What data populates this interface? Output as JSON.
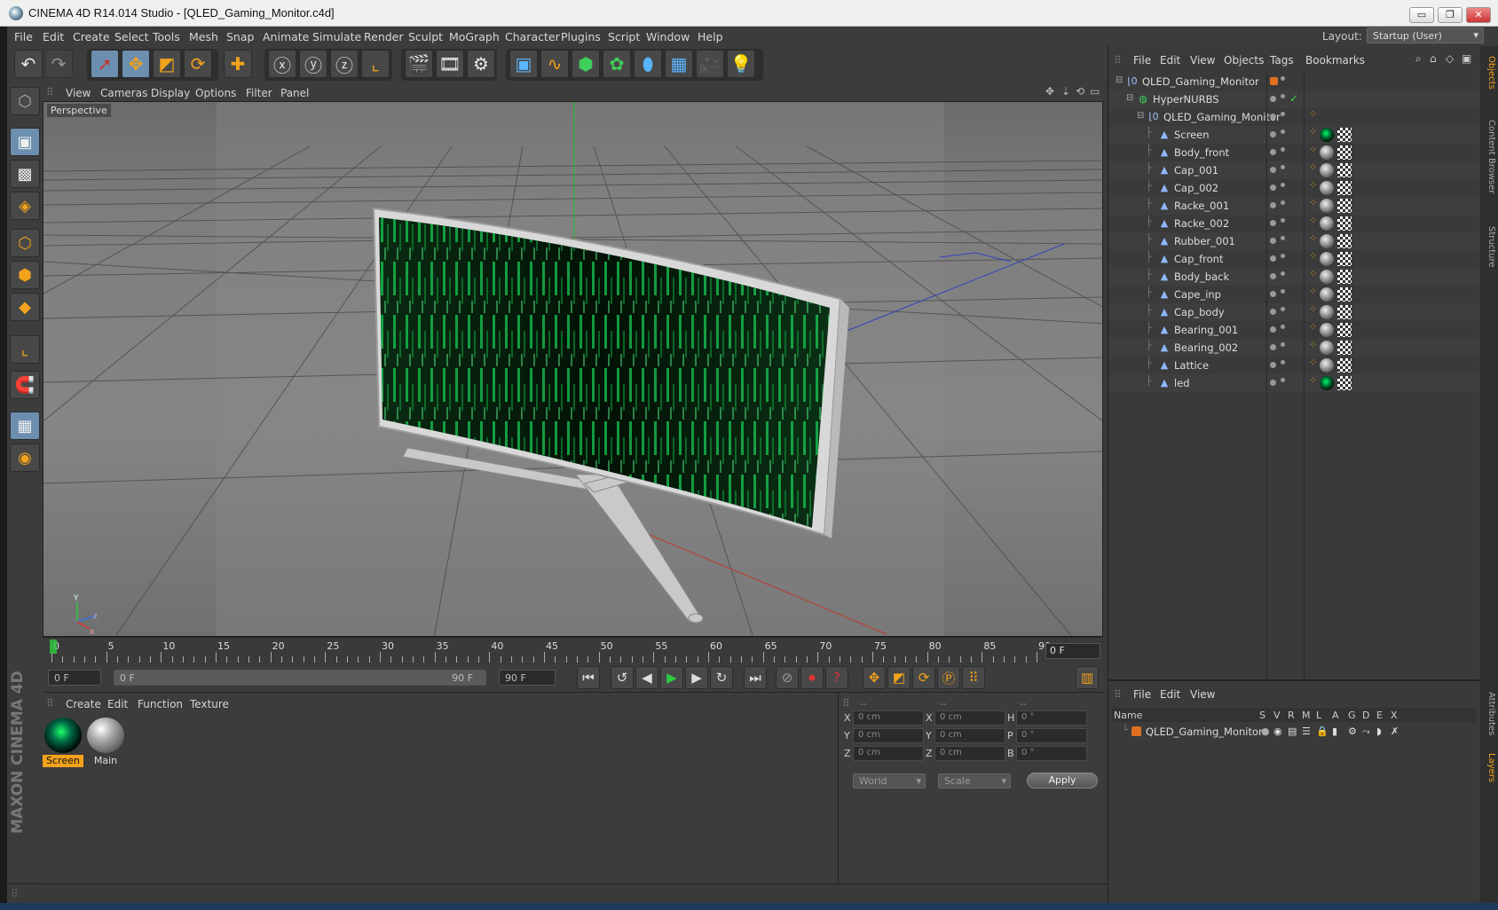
{
  "window": {
    "title": "CINEMA 4D R14.014 Studio - [QLED_Gaming_Monitor.c4d]",
    "controls": {
      "minimize": "▭",
      "maximize": "❐",
      "close": "✕"
    }
  },
  "menubar": {
    "items": [
      "File",
      "Edit",
      "Create",
      "Select",
      "Tools",
      "Mesh",
      "Snap",
      "Animate",
      "Simulate",
      "Render",
      "Sculpt",
      "MoGraph",
      "Character",
      "Plugins",
      "Script",
      "Window",
      "Help"
    ],
    "layout_label": "Layout:",
    "layout_value": "Startup (User)"
  },
  "viewport": {
    "menu": [
      "View",
      "Cameras",
      "Display",
      "Options",
      "Filter",
      "Panel"
    ],
    "label": "Perspective",
    "axis_x": "x",
    "axis_y": "Y",
    "axis_z": "z"
  },
  "timeline": {
    "ticks": [
      "0",
      "5",
      "10",
      "15",
      "20",
      "25",
      "30",
      "35",
      "40",
      "45",
      "50",
      "55",
      "60",
      "65",
      "70",
      "75",
      "80",
      "85",
      "90"
    ],
    "current_frame": "0 F",
    "start_frame": "0 F",
    "range_start": "0 F",
    "range_end": "90 F",
    "end_frame": "90 F"
  },
  "material_manager": {
    "menu": [
      "Create",
      "Edit",
      "Function",
      "Texture"
    ],
    "materials": [
      {
        "name": "Screen",
        "selected": true
      },
      {
        "name": "Main",
        "selected": false
      }
    ]
  },
  "coordinates": {
    "headers": [
      "--",
      "--",
      "--"
    ],
    "rows": [
      {
        "l1": "X",
        "v1": "0 cm",
        "l2": "X",
        "v2": "0 cm",
        "l3": "H",
        "v3": "0 °"
      },
      {
        "l1": "Y",
        "v1": "0 cm",
        "l2": "Y",
        "v2": "0 cm",
        "l3": "P",
        "v3": "0 °"
      },
      {
        "l1": "Z",
        "v1": "0 cm",
        "l2": "Z",
        "v2": "0 cm",
        "l3": "B",
        "v3": "0 °"
      }
    ],
    "space": "World",
    "mode": "Scale",
    "apply": "Apply"
  },
  "object_manager": {
    "menu": [
      "File",
      "Edit",
      "View",
      "Objects",
      "Tags",
      "Bookmarks"
    ],
    "objects": [
      {
        "name": "QLED_Gaming_Monitor",
        "indent": 0,
        "icon": "null-icon",
        "tag": "none"
      },
      {
        "name": "HyperNURBS",
        "indent": 1,
        "icon": "hypernurbs-icon",
        "tag": "none"
      },
      {
        "name": "QLED_Gaming_Monitor",
        "indent": 2,
        "icon": "null-icon",
        "tag": "none"
      },
      {
        "name": "Screen",
        "indent": 3,
        "icon": "polygon-icon",
        "tag": "screen"
      },
      {
        "name": "Body_front",
        "indent": 3,
        "icon": "polygon-icon",
        "tag": "main"
      },
      {
        "name": "Cap_001",
        "indent": 3,
        "icon": "polygon-icon",
        "tag": "main"
      },
      {
        "name": "Cap_002",
        "indent": 3,
        "icon": "polygon-icon",
        "tag": "main"
      },
      {
        "name": "Racke_001",
        "indent": 3,
        "icon": "polygon-icon",
        "tag": "main"
      },
      {
        "name": "Racke_002",
        "indent": 3,
        "icon": "polygon-icon",
        "tag": "main"
      },
      {
        "name": "Rubber_001",
        "indent": 3,
        "icon": "polygon-icon",
        "tag": "main"
      },
      {
        "name": "Cap_front",
        "indent": 3,
        "icon": "polygon-icon",
        "tag": "main"
      },
      {
        "name": "Body_back",
        "indent": 3,
        "icon": "polygon-icon",
        "tag": "main"
      },
      {
        "name": "Cape_inp",
        "indent": 3,
        "icon": "polygon-icon",
        "tag": "main"
      },
      {
        "name": "Cap_body",
        "indent": 3,
        "icon": "polygon-icon",
        "tag": "main"
      },
      {
        "name": "Bearing_001",
        "indent": 3,
        "icon": "polygon-icon",
        "tag": "main"
      },
      {
        "name": "Bearing_002",
        "indent": 3,
        "icon": "polygon-icon",
        "tag": "main"
      },
      {
        "name": "Lattice",
        "indent": 3,
        "icon": "polygon-icon",
        "tag": "main"
      },
      {
        "name": "led",
        "indent": 3,
        "icon": "polygon-icon",
        "tag": "screen"
      }
    ]
  },
  "layer_manager": {
    "menu": [
      "File",
      "Edit",
      "View"
    ],
    "columns": [
      "Name",
      "S",
      "V",
      "R",
      "M",
      "L",
      "A",
      "G",
      "D",
      "E",
      "X"
    ],
    "rows": [
      {
        "name": "QLED_Gaming_Monitor",
        "color": "#e07020"
      }
    ]
  },
  "side_tabs": [
    "Objects",
    "Content Browser",
    "Structure",
    "Attributes",
    "Layers"
  ],
  "brand": "MAXON CINEMA 4D",
  "colors": {
    "accent": "#f2a21b",
    "selection": "#6c8fb0",
    "matrix_green": "#1dff6a"
  }
}
